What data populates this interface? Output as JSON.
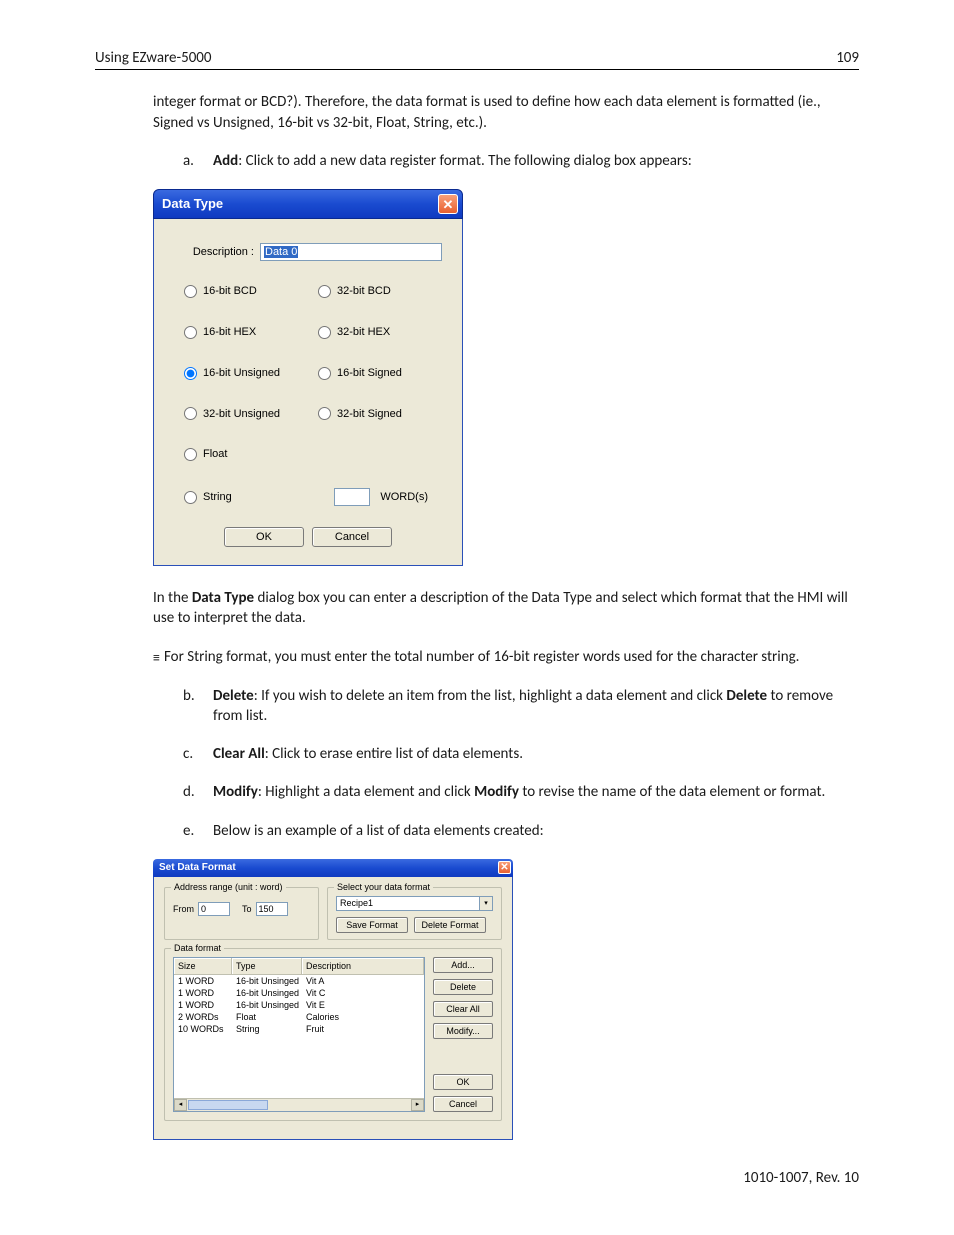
{
  "header": {
    "left": "Using EZware-5000",
    "right": "109"
  },
  "intro": {
    "p1": "integer format or BCD?). Therefore, the data format is used to define how each data element is formatted (ie., Signed vs Unsigned, 16-bit vs 32-bit, Float, String, etc.).",
    "a_letter": "a.",
    "a_bold": "Add",
    "a_rest": ": Click to add a new data register format. The following dialog box appears:"
  },
  "dlg1": {
    "title": "Data Type",
    "description_label": "Description :",
    "description_value": "Data 0",
    "radios": [
      [
        "16-bit BCD",
        "32-bit BCD"
      ],
      [
        "16-bit HEX",
        "32-bit HEX"
      ],
      [
        "16-bit Unsigned",
        "16-bit Signed"
      ],
      [
        "32-bit Unsigned",
        "32-bit Signed"
      ],
      [
        "Float",
        ""
      ],
      [
        "String",
        "WORD(s)"
      ]
    ],
    "selected": "16-bit Unsigned",
    "ok": "OK",
    "cancel": "Cancel"
  },
  "mid": {
    "p2a": "In the ",
    "p2b": "Data Type",
    "p2c": " dialog box you can enter a description of the Data Type and select which format that the HMI will use to interpret the data.",
    "note_icon": "≡",
    "note": "For String format, you must enter the total number of 16-bit register words used for the character string.",
    "b_letter": "b.",
    "b_bold1": "Delete",
    "b_mid": ": If you wish to delete an item from the list, highlight a data element and click ",
    "b_bold2": "Delete",
    "b_end": " to remove from list.",
    "c_letter": "c.",
    "c_bold": "Clear All",
    "c_rest": ": Click to erase entire list of data elements.",
    "d_letter": "d.",
    "d_bold1": "Modify",
    "d_mid": ": Highlight a data element and click ",
    "d_bold2": "Modify",
    "d_end": " to revise the name of the data element or format.",
    "e_letter": "e.",
    "e_text": "Below is an example of a list of data elements created:"
  },
  "dlg2": {
    "title": "Set Data Format",
    "addr_legend": "Address range (unit : word)",
    "from_label": "From",
    "from_value": "0",
    "to_label": "To",
    "to_value": "150",
    "sel_legend": "Select your data format",
    "dropdown_value": "Recipe1",
    "save_btn": "Save Format",
    "delete_fmt_btn": "Delete Format",
    "df_legend": "Data format",
    "columns": [
      "Size",
      "Type",
      "Description"
    ],
    "rows": [
      [
        "1 WORD",
        "16-bit Unsinged",
        "Vit A"
      ],
      [
        "1 WORD",
        "16-bit Unsinged",
        "Vit C"
      ],
      [
        "1 WORD",
        "16-bit Unsinged",
        "Vit E"
      ],
      [
        "2 WORDs",
        "Float",
        "Calories"
      ],
      [
        "10 WORDs",
        "String",
        "Fruit"
      ]
    ],
    "btn_add": "Add...",
    "btn_delete": "Delete",
    "btn_clear": "Clear All",
    "btn_modify": "Modify...",
    "btn_ok": "OK",
    "btn_cancel": "Cancel"
  },
  "footer": "1010-1007, Rev. 10"
}
